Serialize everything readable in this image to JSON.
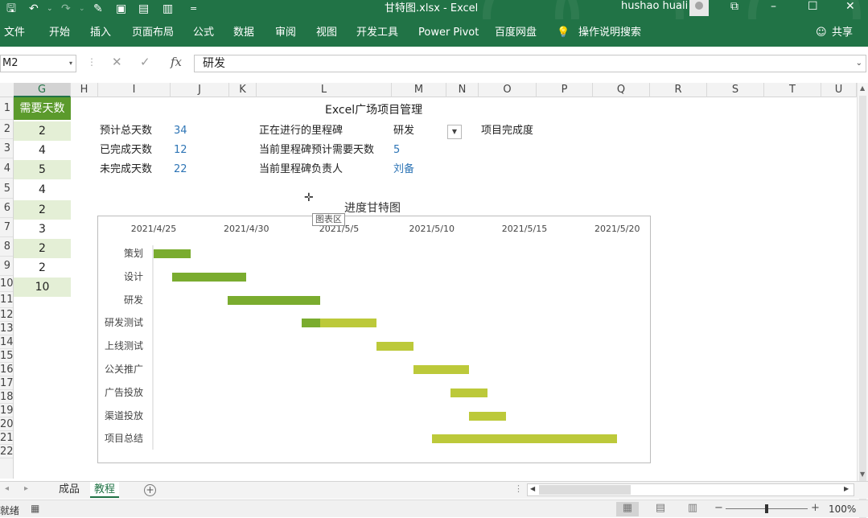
{
  "titlebar": {
    "doc_title": "甘特图.xlsx  -  Excel",
    "user_name": "hushao huali",
    "qa_separator": "=",
    "qa_dropdown": "⌄"
  },
  "ribbon": {
    "tabs": [
      "文件",
      "开始",
      "插入",
      "页面布局",
      "公式",
      "数据",
      "审阅",
      "视图",
      "开发工具",
      "Power Pivot",
      "百度网盘",
      "操作说明搜索"
    ],
    "share_label": "共享"
  },
  "formula_bar": {
    "name_box": "M2",
    "formula_value": "研发",
    "fx_label": "fx"
  },
  "columns": [
    "G",
    "H",
    "I",
    "J",
    "K",
    "L",
    "M",
    "N",
    "O",
    "P",
    "Q",
    "R",
    "S",
    "T",
    "U"
  ],
  "rows": [
    "1",
    "2",
    "3",
    "4",
    "5",
    "6",
    "7",
    "8",
    "9",
    "10",
    "11",
    "12",
    "13",
    "14",
    "15",
    "16",
    "17",
    "18",
    "19",
    "20",
    "21",
    "22"
  ],
  "days_column": {
    "header": "需要天数",
    "values": [
      "2",
      "4",
      "5",
      "4",
      "2",
      "3",
      "2",
      "2",
      "10"
    ]
  },
  "project": {
    "title": "Excel广场项目管理",
    "total_days_label": "预计总天数",
    "total_days": "34",
    "done_days_label": "已完成天数",
    "done_days": "12",
    "remaining_days_label": "未完成天数",
    "remaining_days": "22",
    "milestone_label": "正在进行的里程碑",
    "milestone_value": "研发",
    "milestone_days_label": "当前里程碑预计需要天数",
    "milestone_days": "5",
    "owner_label": "当前里程碑负责人",
    "owner_value": "刘备",
    "completion_label": "项目完成度"
  },
  "chart_tooltip": "图表区",
  "chart_data": {
    "type": "bar",
    "title": "进度甘特图",
    "orientation": "horizontal",
    "x_axis_position": "top",
    "x_ticks": [
      "2021/4/25",
      "2021/4/30",
      "2021/5/5",
      "2021/5/10",
      "2021/5/15",
      "2021/5/20"
    ],
    "xlim": [
      "2021/4/25",
      "2021/5/22"
    ],
    "categories": [
      "策划",
      "设计",
      "研发",
      "研发测试",
      "上线测试",
      "公关推广",
      "广告投放",
      "渠道投放",
      "项目总结"
    ],
    "series": [
      {
        "color": "#7aac2f",
        "values": [
          [
            "2021/4/25",
            "2021/4/27"
          ],
          [
            "2021/4/26",
            "2021/4/30"
          ],
          [
            "2021/4/29",
            "2021/5/4"
          ],
          [
            "2021/5/3",
            "2021/5/4"
          ],
          null,
          null,
          null,
          null,
          null
        ]
      },
      {
        "color": "#bcc93a",
        "values": [
          null,
          null,
          null,
          [
            "2021/5/4",
            "2021/5/7"
          ],
          [
            "2021/5/7",
            "2021/5/9"
          ],
          [
            "2021/5/9",
            "2021/5/12"
          ],
          [
            "2021/5/11",
            "2021/5/13"
          ],
          [
            "2021/5/12",
            "2021/5/14"
          ],
          [
            "2021/5/10",
            "2021/5/20"
          ]
        ]
      }
    ],
    "grid": false,
    "legend": "none"
  },
  "sheets": [
    {
      "label": "成品",
      "active": false
    },
    {
      "label": "教程",
      "active": true
    }
  ],
  "status": {
    "ready_label": "就绪",
    "zoom": "100%",
    "zoom_minus": "−",
    "zoom_plus": "+"
  }
}
